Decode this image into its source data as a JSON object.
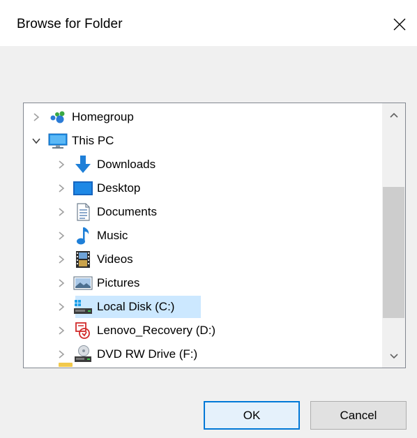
{
  "dialog": {
    "title": "Browse for Folder",
    "instruction": "",
    "ok_label": "OK",
    "cancel_label": "Cancel"
  },
  "tree": {
    "items": [
      {
        "label": "Homegroup",
        "icon": "homegroup-icon",
        "level": 0,
        "expander": "collapsed"
      },
      {
        "label": "This PC",
        "icon": "this-pc-icon",
        "level": 0,
        "expander": "expanded"
      },
      {
        "label": "Downloads",
        "icon": "downloads-icon",
        "level": 1,
        "expander": "collapsed"
      },
      {
        "label": "Desktop",
        "icon": "desktop-icon",
        "level": 1,
        "expander": "collapsed"
      },
      {
        "label": "Documents",
        "icon": "documents-icon",
        "level": 1,
        "expander": "collapsed"
      },
      {
        "label": "Music",
        "icon": "music-icon",
        "level": 1,
        "expander": "collapsed"
      },
      {
        "label": "Videos",
        "icon": "videos-icon",
        "level": 1,
        "expander": "collapsed"
      },
      {
        "label": "Pictures",
        "icon": "pictures-icon",
        "level": 1,
        "expander": "collapsed"
      },
      {
        "label": "Local Disk (C:)",
        "icon": "local-disk-icon",
        "level": 1,
        "expander": "collapsed",
        "selected": true
      },
      {
        "label": "Lenovo_Recovery (D:)",
        "icon": "recovery-drive-icon",
        "level": 1,
        "expander": "collapsed"
      },
      {
        "label": "DVD RW Drive (F:)",
        "icon": "dvd-drive-icon",
        "level": 1,
        "expander": "collapsed"
      }
    ]
  },
  "colors": {
    "accent": "#0078d7",
    "selection": "#cce8ff",
    "dialog_bg": "#f0f0f0"
  }
}
